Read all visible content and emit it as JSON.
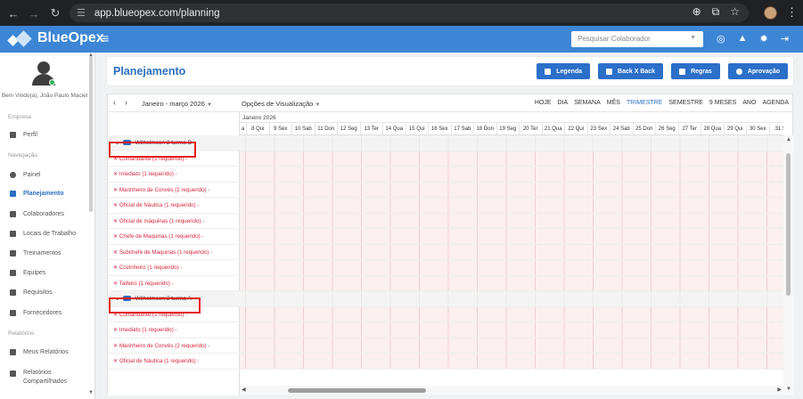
{
  "browser": {
    "url": "app.blueopex.com/planning"
  },
  "app": {
    "brand": "BlueOpex",
    "search_placeholder": "Pesquisar Colaborador"
  },
  "sidebar": {
    "welcome": "Bem Vindo(a), João Paulo Maciel",
    "sections": [
      "Empresa",
      "Navegação",
      "Relatórios"
    ],
    "items": [
      {
        "label": "Perfil",
        "icon": "briefcase-icon"
      },
      {
        "label": "Painel",
        "icon": "gauge-icon"
      },
      {
        "label": "Planejamento",
        "icon": "calendar-icon",
        "active": true
      },
      {
        "label": "Colaboradores",
        "icon": "users-icon"
      },
      {
        "label": "Locais de Trabalho",
        "icon": "building-icon"
      },
      {
        "label": "Treinamentos",
        "icon": "training-icon"
      },
      {
        "label": "Equipes",
        "icon": "team-icon"
      },
      {
        "label": "Requisitos",
        "icon": "checkbox-icon"
      },
      {
        "label": "Fornecedores",
        "icon": "briefcase-icon"
      },
      {
        "label": "Meus Relatórios",
        "icon": "report-icon"
      },
      {
        "label": "Relatórios Compartilhados",
        "icon": "share-icon"
      }
    ]
  },
  "page": {
    "title": "Planejamento",
    "buttons": [
      "Legenda",
      "Back X Back",
      "Regras",
      "Aprovação"
    ]
  },
  "toolbar": {
    "range": "Janeiro - março 2026",
    "options": "Opções de Visualização",
    "views": [
      "HOJE",
      "DIA",
      "SEMANA",
      "MÊS",
      "TRIMESTRE",
      "SEMESTRE",
      "9 MESES",
      "ANO",
      "AGENDA"
    ],
    "active_view": "TRIMESTRE"
  },
  "timeline": {
    "month": "Janeiro 2026",
    "days": [
      "a",
      "8 Qui",
      "9 Sex",
      "10 Sab",
      "11 Don",
      "12 Seg",
      "13 Ter",
      "14 Qua",
      "15 Qui",
      "16 Sex",
      "17 Sab",
      "18 Don",
      "19 Seg",
      "20 Ter",
      "21 Qua",
      "22 Qui",
      "23 Sex",
      "24 Sab",
      "25 Don",
      "26 Seg",
      "27 Ter",
      "28 Qua",
      "29 Qui",
      "30 Sex",
      "31 S"
    ]
  },
  "rows": [
    {
      "type": "group",
      "label": "Wilhelmsen 2 turma B"
    },
    {
      "type": "task",
      "label": "Comandante (1 requerido) -"
    },
    {
      "type": "task",
      "label": "Imediato (1 requerido) -"
    },
    {
      "type": "task",
      "label": "Marinheiro de Convés (2 requerido) -"
    },
    {
      "type": "task",
      "label": "Oficial de Náutica (1 requerido) -"
    },
    {
      "type": "task",
      "label": "Oficial de máquinas (1 requerido) -"
    },
    {
      "type": "task",
      "label": "Chefe de Maquinas (1 requerido) -"
    },
    {
      "type": "task",
      "label": "Subchefe de Maquinas (1 requerido) -"
    },
    {
      "type": "task",
      "label": "Cozinheiro (1 requerido) -"
    },
    {
      "type": "task",
      "label": "Taifeiro (1 requerido) -"
    },
    {
      "type": "group",
      "label": "Wilhelmsen 2 turma A"
    },
    {
      "type": "task",
      "label": "Comandante (1 requerido) -"
    },
    {
      "type": "task",
      "label": "Imediato (1 requerido) -"
    },
    {
      "type": "task",
      "label": "Marinheiro de Convés (2 requerido) -"
    },
    {
      "type": "task",
      "label": "Oficial de Náutica (1 requerido) -"
    }
  ],
  "colors": {
    "appbar": "#3d86d6",
    "accent": "#2a6ebf",
    "button": "#2c6fc9",
    "requirement_text": "#d7263d",
    "highlight_box": "#e21b1b"
  }
}
